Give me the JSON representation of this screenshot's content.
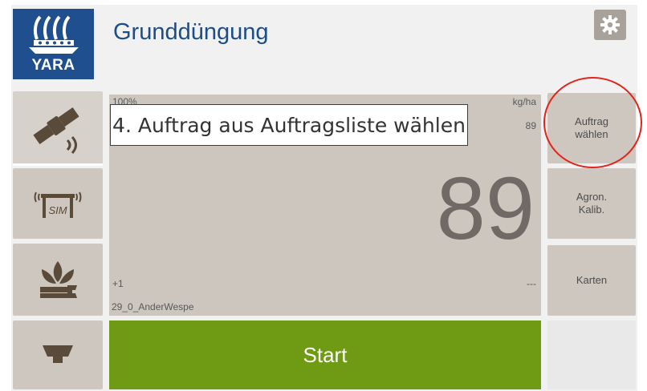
{
  "header": {
    "title": "Grunddüngung",
    "logo_text": "YARA"
  },
  "icons": {
    "settings": "gear-icon",
    "left_buttons": [
      "satellite-icon",
      "sim-spreader-icon",
      "plant-wrench-icon",
      "spread-disc-icon"
    ]
  },
  "display": {
    "top_left": "100%",
    "unit": "kg/ha",
    "target_rate": "89",
    "current_rate": "89",
    "offset": "+1",
    "right_status": "---",
    "job_name": "29_0_AnderWespe"
  },
  "instruction": "4. Auftrag aus Auftragsliste wählen",
  "right_buttons": {
    "select_job": [
      "Auftrag",
      "wählen"
    ],
    "agron_calib": [
      "Agron.",
      "Kalib."
    ],
    "maps": "Karten"
  },
  "start_label": "Start",
  "colors": {
    "brand_blue": "#1f4f8f",
    "panel": "#ccc6bf",
    "start_green": "#6f9a13",
    "highlight_red": "#e2231a"
  }
}
